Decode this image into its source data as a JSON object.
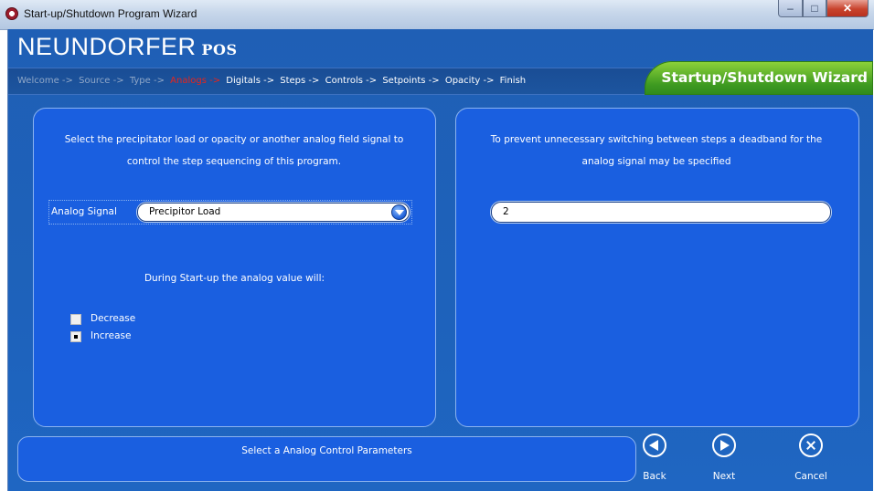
{
  "window": {
    "title": "Start-up/Shutdown Program Wizard"
  },
  "brand": {
    "name": "NEUNDORFER",
    "suffix": "POS"
  },
  "wizard": {
    "title": "Startup/Shutdown Wizard",
    "steps": [
      {
        "label": "Welcome ->",
        "state": "done"
      },
      {
        "label": "Source ->",
        "state": "done"
      },
      {
        "label": "Type ->",
        "state": "done"
      },
      {
        "label": "Analogs ->",
        "state": "current"
      },
      {
        "label": "Digitals ->",
        "state": "next"
      },
      {
        "label": "Steps ->",
        "state": "next"
      },
      {
        "label": "Controls ->",
        "state": "next"
      },
      {
        "label": "Setpoints ->",
        "state": "next"
      },
      {
        "label": "Opacity ->",
        "state": "next"
      },
      {
        "label": "Finish",
        "state": "next"
      }
    ]
  },
  "left_panel": {
    "description_line1": "Select the precipitator load or opacity or another analog field signal to",
    "description_line2": "control the step sequencing of this program.",
    "signal_label": "Analog Signal",
    "signal_value": "Precipitor Load",
    "direction_prompt": "During Start-up the analog value will:",
    "options": [
      {
        "label": "Decrease",
        "checked": false
      },
      {
        "label": "Increase",
        "checked": true
      }
    ]
  },
  "right_panel": {
    "description_line1": "To prevent unnecessary switching between steps a deadband for the",
    "description_line2": "analog signal may be specified",
    "deadband_value": "2"
  },
  "status": {
    "message": "Select a Analog Control Parameters"
  },
  "nav": {
    "back": "Back",
    "next": "Next",
    "cancel": "Cancel"
  },
  "colors": {
    "panel": "#1a5fe0",
    "accent_green": "#3e9a21",
    "current_step": "#e8241b"
  },
  "icons": {
    "app": "app-logo-icon",
    "back": "back-arrow-icon",
    "next": "next-arrow-icon",
    "cancel": "cancel-x-icon",
    "dropdown": "chevron-down-icon"
  }
}
